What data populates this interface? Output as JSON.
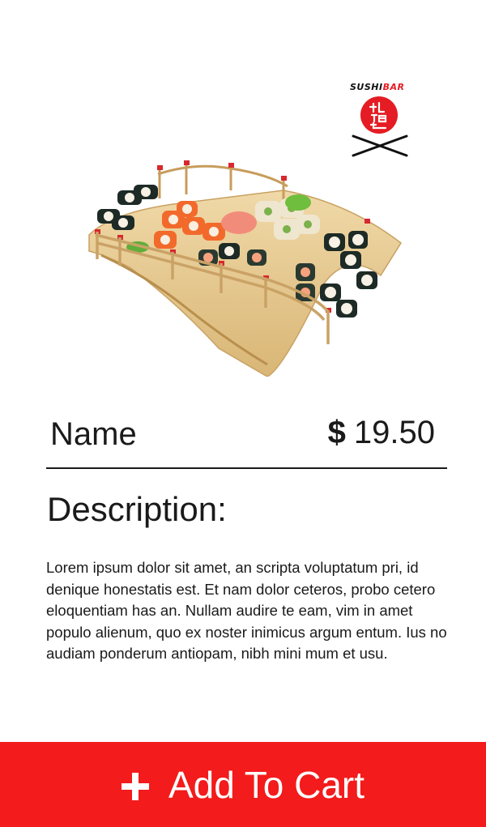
{
  "logo": {
    "brand_sushi": "SUSHI",
    "brand_bar": "BAR"
  },
  "product": {
    "name": "Name",
    "currency": "$",
    "price": "19.50"
  },
  "description": {
    "heading": "Description:",
    "body": "Lorem ipsum dolor sit amet, an scripta voluptatum pri, id denique honestatis est. Et nam dolor ceteros, probo cetero eloquentiam has an. Nullam audire te eam, vim in amet populo alienum, quo ex noster inimicus argum entum. Ius no audiam ponderum antiopam, nibh mini mum et usu."
  },
  "cta": {
    "label": "Add To Cart",
    "icon": "plus-icon"
  },
  "colors": {
    "accent": "#f31b1b",
    "text": "#1a1a1a",
    "wood": "#e3c48f"
  }
}
